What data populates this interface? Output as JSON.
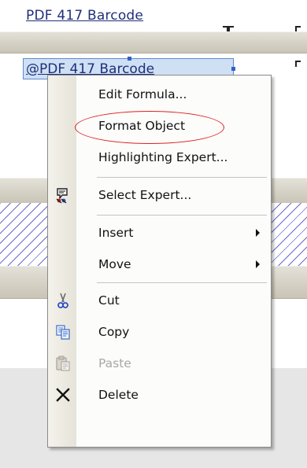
{
  "report": {
    "header_field_label": "PDF 417 Barcode",
    "selected_field_label": "@PDF 417 Barcode"
  },
  "context_menu": {
    "items": [
      {
        "label": "Edit Formula...",
        "icon": "",
        "enabled": true
      },
      {
        "label": "Format Object",
        "icon": "",
        "enabled": true,
        "highlighted_by_annotation": true
      },
      {
        "label": "Highlighting Expert...",
        "icon": "",
        "enabled": true
      },
      {
        "label": "Select Expert...",
        "icon": "select-expert-icon",
        "enabled": true
      },
      {
        "label": "Insert",
        "icon": "",
        "enabled": true,
        "has_submenu": true
      },
      {
        "label": "Move",
        "icon": "",
        "enabled": true,
        "has_submenu": true
      },
      {
        "label": "Cut",
        "icon": "scissors-icon",
        "enabled": true
      },
      {
        "label": "Copy",
        "icon": "copy-icon",
        "enabled": true
      },
      {
        "label": "Paste",
        "icon": "paste-icon",
        "enabled": false
      },
      {
        "label": "Delete",
        "icon": "delete-x-icon",
        "enabled": true
      }
    ]
  },
  "colors": {
    "annotation": "#e02020",
    "selection_fill": "#cfe0f4",
    "selection_border": "#5b8ad0",
    "field_text": "#1f2f7a"
  }
}
